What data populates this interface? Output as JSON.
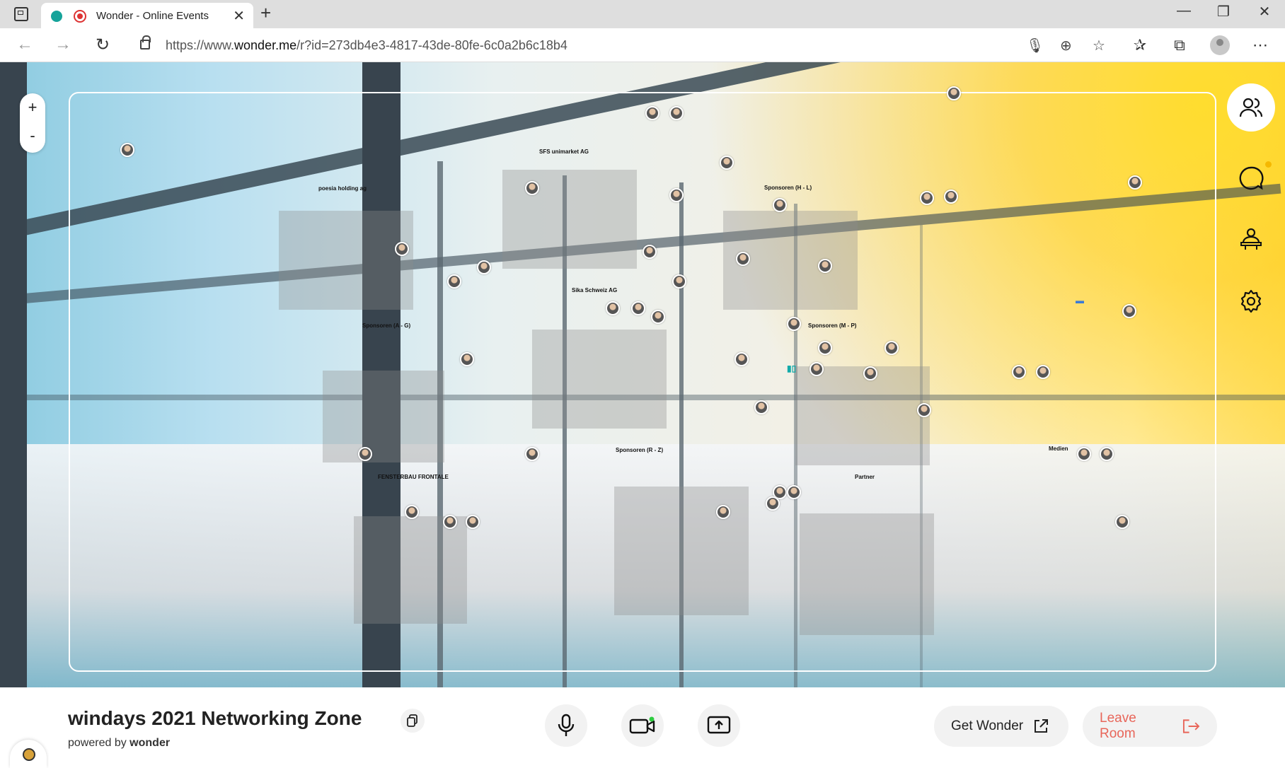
{
  "browser": {
    "tab_title": "Wonder - Online Events",
    "url_prefix": "https://www.",
    "url_domain": "wonder.me",
    "url_path": "/r?id=273db4e3-4817-43de-80fe-6c0a2b6c18b4"
  },
  "zoom": {
    "in_label": "+",
    "out_label": "-"
  },
  "rooms": [
    {
      "label": "poesia holding ag"
    },
    {
      "label": "SFS unimarket AG"
    },
    {
      "label": "Sponsoren (H - L)"
    },
    {
      "label": "Sika Schweiz AG"
    },
    {
      "label": "Sponsoren (A - G)"
    },
    {
      "label": "Sponsoren (M - P)"
    },
    {
      "label": "Sponsoren (R - Z)"
    },
    {
      "label": "FENSTERBAU FRONTALE"
    },
    {
      "label": "Partner"
    },
    {
      "label": "Medien"
    }
  ],
  "sidebar": {
    "icons": [
      "people-icon",
      "chat-icon",
      "host-icon",
      "settings-icon"
    ]
  },
  "footer": {
    "room_title": "windays 2021 Networking Zone",
    "powered_prefix": "powered by",
    "powered_brand": "wonder",
    "get_wonder_label": "Get Wonder",
    "leave_room_label": "Leave Room"
  },
  "colors": {
    "leave": "#e8665a",
    "accent_dot": "#f5b800",
    "camera_status": "#2ecc40"
  }
}
